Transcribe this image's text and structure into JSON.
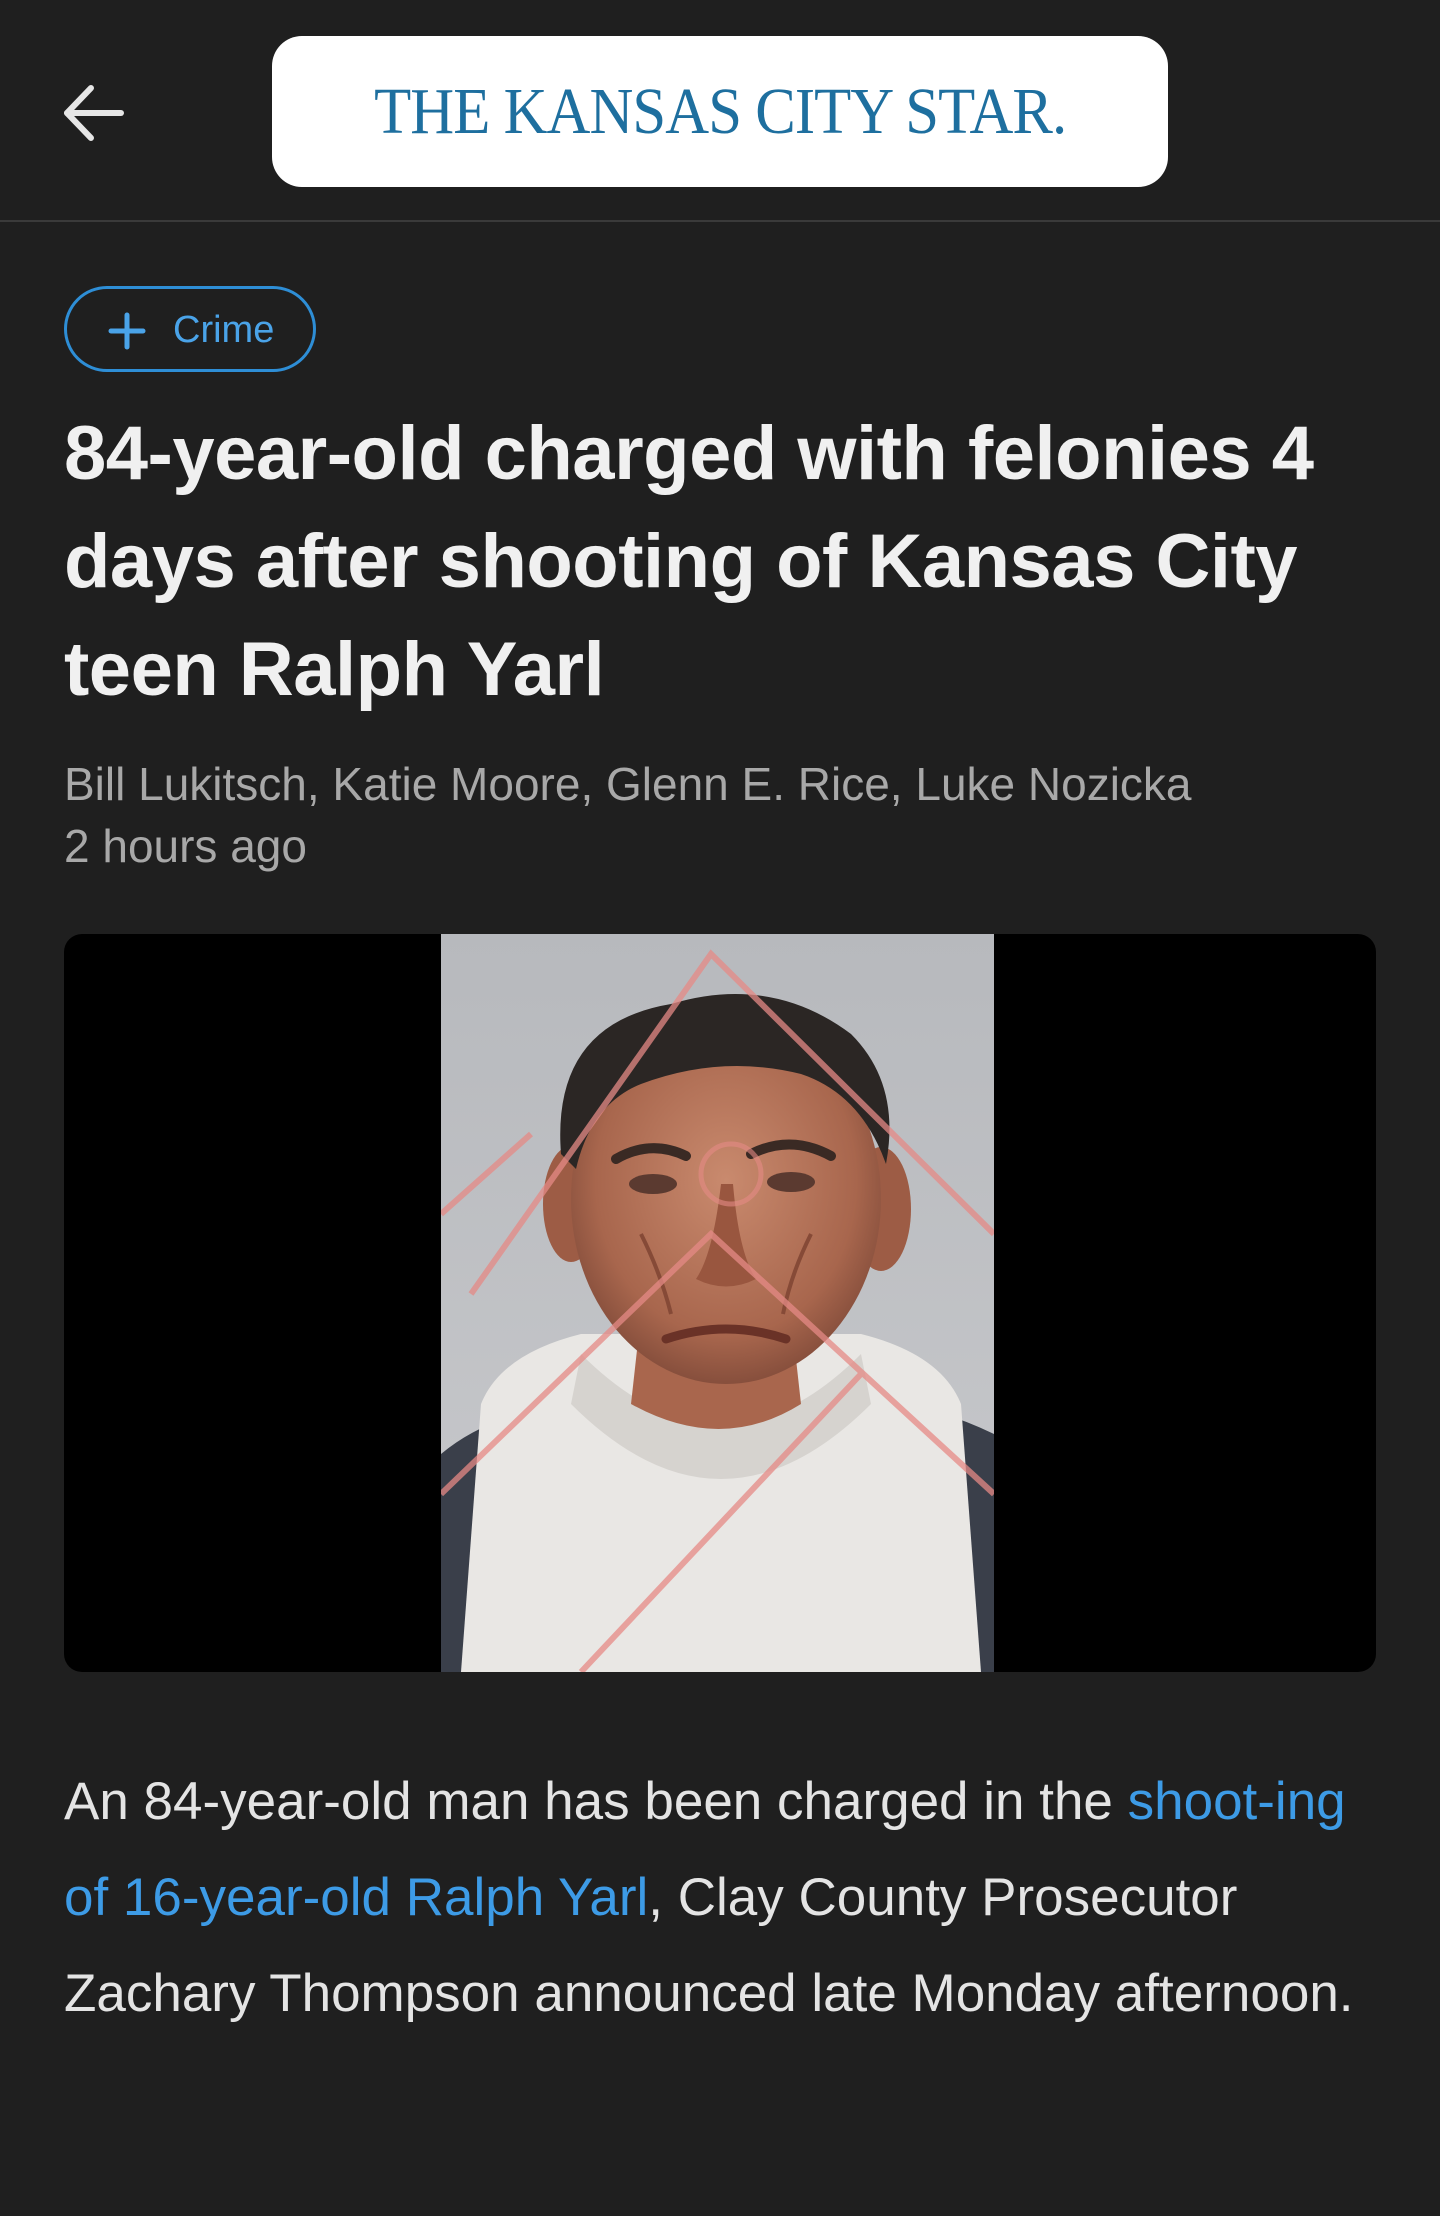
{
  "header": {
    "logo_text": "THE KANSAS CITY STAR.",
    "back_icon": "arrow-left-icon"
  },
  "article": {
    "tag": {
      "label": "Crime",
      "icon": "plus-icon"
    },
    "headline": "84-year-old charged with felonies 4 days after shooting of Kansas City teen Ralph Yarl",
    "byline": "Bill Lukitsch, Katie Moore, Glenn E. Rice, Luke Nozicka",
    "timestamp": "2 hours ago",
    "body": {
      "text_before": "An 84-year-old man has been charged in the ",
      "link_text": "shoot-ing of 16-year-old Ralph Yarl",
      "text_after": ", Clay County Prosecutor Zachary Thompson announced late Monday afternoon."
    }
  },
  "colors": {
    "background": "#1f1f1f",
    "accent": "#2e8ed6",
    "link": "#3d9be6",
    "logo": "#1e6f9f"
  }
}
